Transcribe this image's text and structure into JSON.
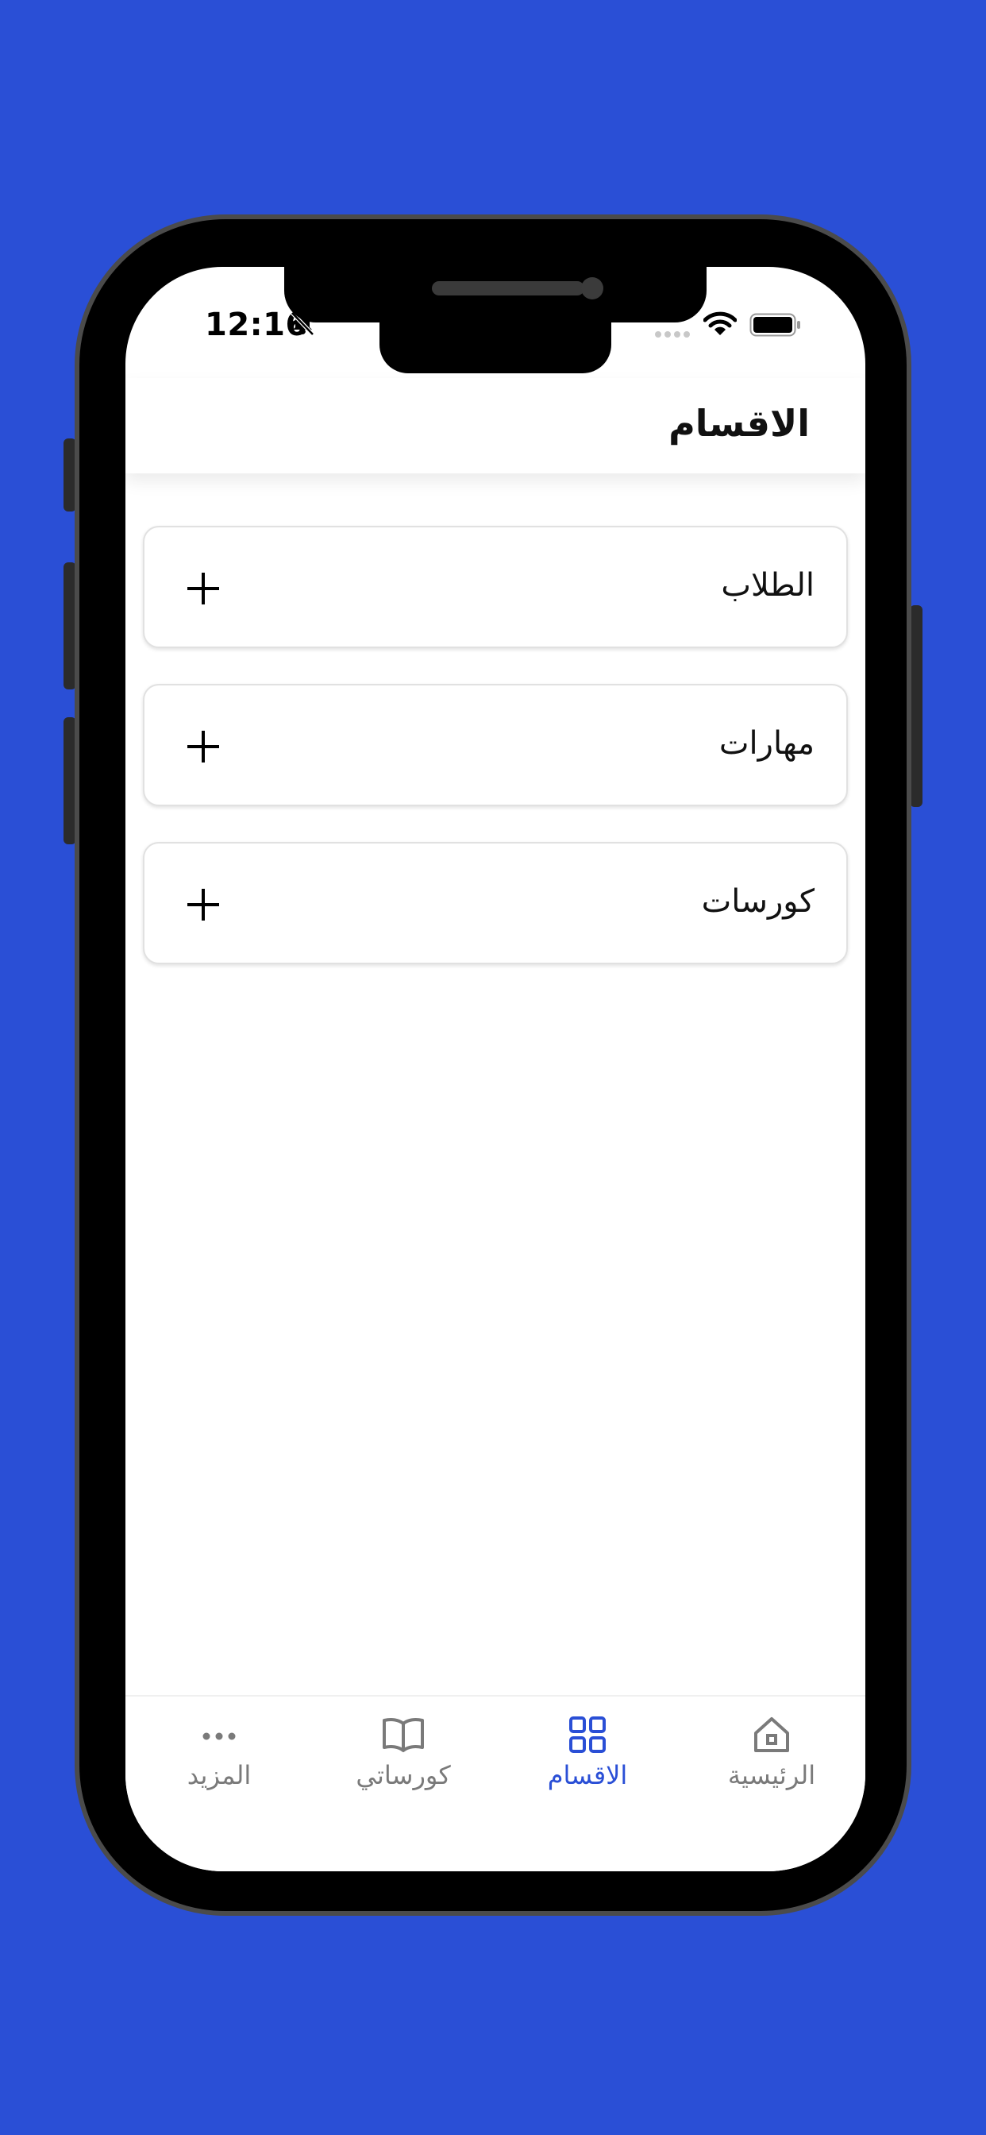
{
  "status_bar": {
    "time": "12:16"
  },
  "header": {
    "title": "الاقسام"
  },
  "sections": [
    {
      "label": "الطلاب"
    },
    {
      "label": "مهارات"
    },
    {
      "label": "كورسات"
    }
  ],
  "tabbar": {
    "home": "الرئيسية",
    "sections": "الاقسام",
    "my_courses": "كورساتي",
    "more": "المزيد"
  },
  "colors": {
    "background": "#2a4fd6",
    "accent": "#2a4fd6",
    "inactive": "#7a7a7a"
  }
}
